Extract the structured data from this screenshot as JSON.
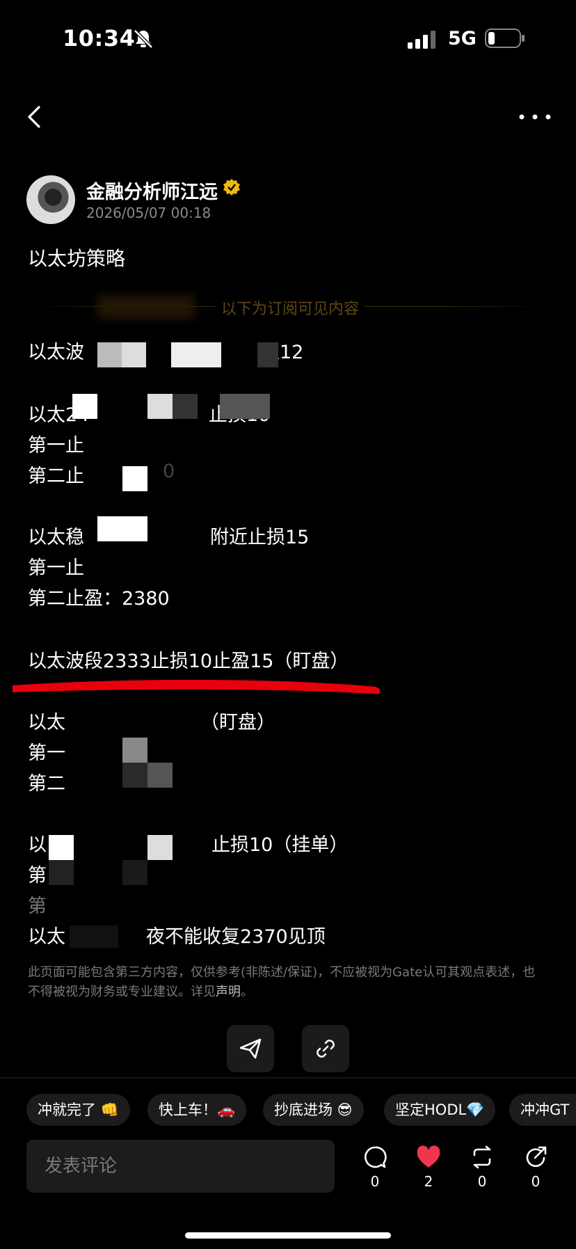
{
  "status_bar": {
    "time": "10:34",
    "network": "5G"
  },
  "author": {
    "name": "金融分析师江远",
    "date": "2026/05/07 00:18"
  },
  "post": {
    "title": "以太坊策略",
    "subscriber_divider": "以下为订阅可见内容",
    "lines": [
      "以太波",
      "盈12",
      "以太24",
      "止损10",
      "第一止",
      "第二止",
      "0",
      "以太稳",
      "附近止损15",
      "第一止",
      "第二止盈：2380",
      "以太波段2333止损10止盈15（盯盘）",
      "以太",
      "（盯盘）",
      "第一",
      "第二",
      "以",
      "止损10（挂单）",
      "第",
      "第",
      "以太",
      "夜不能收复2370见顶"
    ],
    "disclaimer": "此页面可能包含第三方内容，仅供参考(非陈述/保证)，不应被视为Gate认可其观点表述，也不得被视为财务或专业建议。详见",
    "disclaimer_link": "声明",
    "disclaimer_end": "。"
  },
  "quick_replies": [
    "冲就完了 👊",
    "快上车！🚗",
    "抄底进场 😎",
    "坚定HODL💎",
    "冲冲GT"
  ],
  "comment": {
    "placeholder": "发表评论"
  },
  "actions": {
    "comments": "0",
    "likes": "2",
    "reposts": "0",
    "shares": "0"
  },
  "colors": {
    "accent_gold": "#f0b90b",
    "like_red": "#f0364f",
    "highlight_red": "#e8000d"
  }
}
